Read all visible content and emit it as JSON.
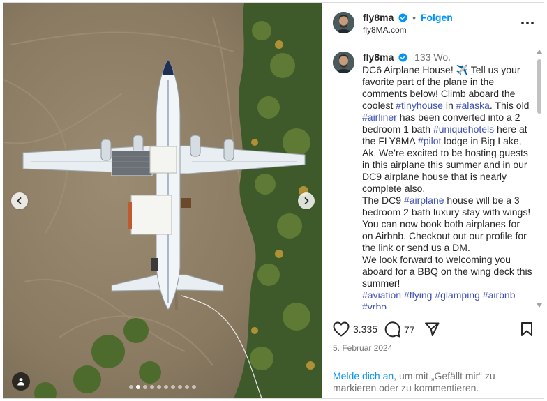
{
  "post": {
    "username": "fly8ma",
    "follow_label": "Folgen",
    "subtitle": "fly8MA.com",
    "time_ago": "133 Wo.",
    "caption": [
      [
        {
          "t": "DC6 Airplane House! ✈️ Tell us your favorite part of the plane in the comments below!  Climb aboard the coolest "
        },
        {
          "t": "#tinyhouse",
          "tag": true
        },
        {
          "t": " in "
        },
        {
          "t": "#alaska",
          "tag": true
        },
        {
          "t": ".  This old "
        },
        {
          "t": "#airliner",
          "tag": true
        },
        {
          "t": " has been converted into a 2 bedroom 1 bath "
        },
        {
          "t": "#uniquehotels",
          "tag": true
        },
        {
          "t": " here at the FLY8MA "
        },
        {
          "t": "#pilot",
          "tag": true
        },
        {
          "t": " lodge in Big Lake, Ak.  We’re excited to be hosting guests in this airplane this summer and in our DC9 airplane house that is nearly complete also."
        }
      ],
      [
        {
          "t": "The DC9 "
        },
        {
          "t": "#airplane",
          "tag": true
        },
        {
          "t": " house will be a 3 bedroom 2 bath luxury stay with wings! You can now book both airplanes for on Airbnb.  Checkout out our profile for the link or send us a DM."
        }
      ],
      [
        {
          "t": "We look forward to welcoming you aboard for a BBQ on the wing deck this summer!"
        }
      ],
      [
        {
          "t": "#aviation",
          "tag": true
        },
        {
          "t": " "
        },
        {
          "t": "#flying",
          "tag": true
        },
        {
          "t": " "
        },
        {
          "t": "#glamping",
          "tag": true
        },
        {
          "t": " "
        },
        {
          "t": "#airbnb",
          "tag": true
        },
        {
          "t": " "
        },
        {
          "t": "#vrbo",
          "tag": true
        }
      ]
    ],
    "likes": "3.335",
    "comments_count": "77",
    "date": "5. Februar 2024",
    "carousel": {
      "count": 10,
      "active": 1
    }
  },
  "login_prompt": {
    "link": "Melde dich an",
    "rest": ", um mit „Gefällt mir“ zu markieren oder zu kommentieren."
  },
  "icons": [
    "verified-badge-icon",
    "more-options-icon",
    "heart-icon",
    "comment-icon",
    "share-icon",
    "save-icon",
    "chevron-left-icon",
    "chevron-right-icon",
    "tagged-user-icon"
  ],
  "colors": {
    "accent": "#0095f6",
    "hashtag": "#3f51b5",
    "text": "#262626",
    "muted": "#737373"
  }
}
